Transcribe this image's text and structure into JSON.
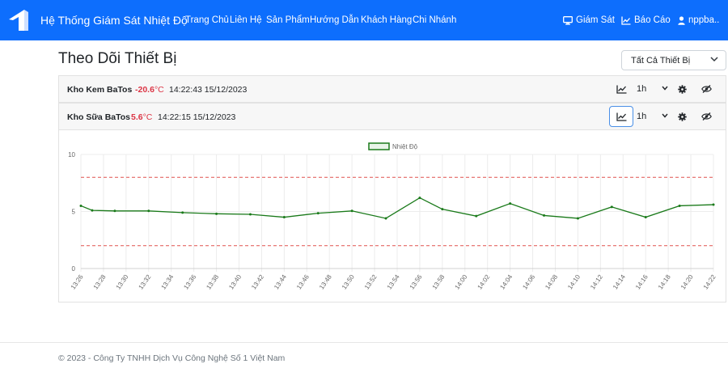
{
  "navbar": {
    "brand": "Hệ Thống Giám Sát Nhiệt Độ",
    "links": [
      "Trang Chủ",
      "Liên Hệ",
      "Sản Phẩm",
      "Hướng Dẫn",
      "Khách Hàng",
      "Chi Nhánh"
    ],
    "monitor_label": "Giám Sát",
    "report_label": "Báo Cáo",
    "user_label": "nppba..",
    "bg_color": "#0d6efd"
  },
  "page": {
    "title": "Theo Dõi Thiết Bị",
    "device_filter": {
      "selected": "Tất Cả Thiết Bị"
    }
  },
  "devices": [
    {
      "name": "Kho Kem BaTos",
      "temp": "-20.6",
      "unit": "°C",
      "time": "14:22:43 15/12/2023",
      "range": "1h"
    },
    {
      "name": "Kho Sữa BaTos",
      "temp": "5.6",
      "unit": "°C",
      "time": "14:22:15 15/12/2023",
      "range": "1h"
    }
  ],
  "chart_data": {
    "type": "line",
    "legend": "Nhiệt Độ",
    "line_color": "#1a7a1a",
    "threshold_color": "#e0524f",
    "ylim": [
      0,
      10
    ],
    "yticks": [
      0,
      5,
      10
    ],
    "thresholds": [
      8,
      2
    ],
    "categories": [
      "13:26",
      "13:28",
      "13:30",
      "13:32",
      "13:34",
      "13:36",
      "13:38",
      "13:40",
      "13:42",
      "13:44",
      "13:46",
      "13:48",
      "13:50",
      "13:52",
      "13:54",
      "13:56",
      "13:58",
      "14:00",
      "14:02",
      "14:04",
      "14:06",
      "14:08",
      "14:10",
      "14:12",
      "14:14",
      "14:16",
      "14:18",
      "14:20",
      "14:22"
    ],
    "series": [
      {
        "x": [
          "13:26",
          "13:27",
          "13:29",
          "13:32",
          "13:35",
          "13:38",
          "13:41",
          "13:44",
          "13:47",
          "13:50",
          "13:53",
          "13:56",
          "13:58",
          "14:01",
          "14:04",
          "14:07",
          "14:10",
          "14:13",
          "14:16",
          "14:19",
          "14:22"
        ],
        "values": [
          5.5,
          5.1,
          5.05,
          5.05,
          4.9,
          4.8,
          4.75,
          4.5,
          4.85,
          5.05,
          4.4,
          6.2,
          5.2,
          4.6,
          5.7,
          4.65,
          4.4,
          5.4,
          4.5,
          5.5,
          5.6
        ]
      }
    ]
  },
  "footer": {
    "text": "© 2023 - Công Ty TNHH Dịch Vụ Công Nghệ Số 1 Việt Nam"
  }
}
